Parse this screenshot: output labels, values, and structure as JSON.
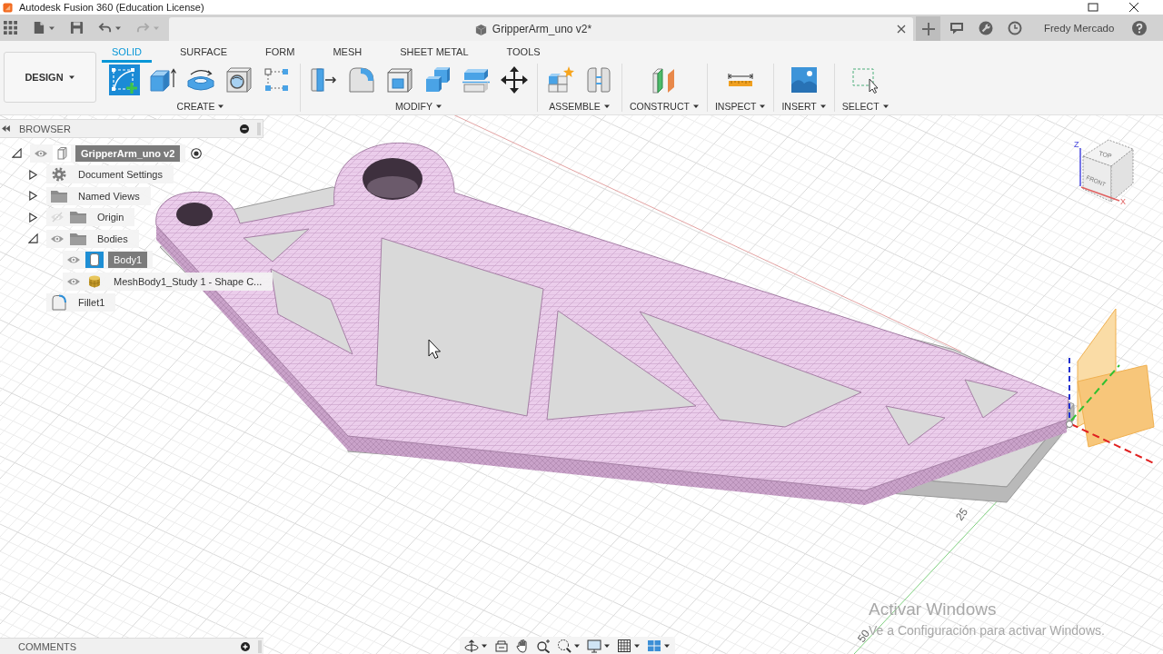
{
  "title_bar": {
    "title": "Autodesk Fusion 360 (Education License)"
  },
  "tab_bar": {
    "quick_access": [
      {
        "kind": "apps",
        "dropdown": false,
        "disabled": false
      },
      {
        "kind": "file",
        "dropdown": true,
        "disabled": false
      },
      {
        "kind": "save",
        "dropdown": false,
        "disabled": false
      },
      {
        "kind": "undo",
        "dropdown": true,
        "disabled": false
      },
      {
        "kind": "redo",
        "dropdown": true,
        "disabled": true
      }
    ],
    "document_tab": {
      "title": "GripperArm_uno v2*",
      "selected": true
    },
    "actions": [
      {
        "kind": "new-tab"
      },
      {
        "kind": "comments"
      },
      {
        "kind": "job-status"
      },
      {
        "kind": "clock"
      }
    ],
    "user_name": "Fredy Mercado"
  },
  "toolbar": {
    "workspace": "DESIGN",
    "tabs": [
      {
        "label": "SOLID",
        "selected": true
      },
      {
        "label": "SURFACE",
        "selected": false
      },
      {
        "label": "FORM",
        "selected": false
      },
      {
        "label": "MESH",
        "selected": false
      },
      {
        "label": "SHEET METAL",
        "selected": false
      },
      {
        "label": "TOOLS",
        "selected": false
      }
    ],
    "groups": [
      {
        "label": "CREATE",
        "tools": [
          {
            "kind": "sketch",
            "selected": true
          },
          {
            "kind": "extrude",
            "selected": false
          },
          {
            "kind": "revolve",
            "selected": false
          },
          {
            "kind": "hole",
            "selected": false
          },
          {
            "kind": "pattern",
            "selected": false
          }
        ]
      },
      {
        "label": "MODIFY",
        "tools": [
          {
            "kind": "press-pull",
            "selected": false
          },
          {
            "kind": "fillet",
            "selected": false
          },
          {
            "kind": "shell",
            "selected": false
          },
          {
            "kind": "combine",
            "selected": false
          },
          {
            "kind": "split",
            "selected": false
          },
          {
            "kind": "move",
            "selected": false
          }
        ]
      },
      {
        "label": "ASSEMBLE",
        "tools": [
          {
            "kind": "new-component",
            "selected": false
          },
          {
            "kind": "joint",
            "selected": false
          }
        ]
      },
      {
        "label": "CONSTRUCT",
        "tools": [
          {
            "kind": "plane",
            "selected": false
          }
        ]
      },
      {
        "label": "INSPECT",
        "tools": [
          {
            "kind": "measure",
            "selected": false
          }
        ]
      },
      {
        "label": "INSERT",
        "tools": [
          {
            "kind": "image",
            "selected": false
          }
        ]
      },
      {
        "label": "SELECT",
        "tools": [
          {
            "kind": "select",
            "selected": false
          }
        ]
      }
    ]
  },
  "browser": {
    "title": "BROWSER",
    "tree": [
      {
        "label": "GripperArm_uno v2",
        "kind": "component",
        "expanded": true,
        "visible": true,
        "active": true,
        "selected": false,
        "children": [
          {
            "label": "Document Settings",
            "kind": "gear",
            "expanded": false,
            "selected": false
          },
          {
            "label": "Named Views",
            "kind": "folder",
            "expanded": false,
            "selected": false
          },
          {
            "label": "Origin",
            "kind": "folder",
            "expanded": false,
            "visible": false,
            "selected": false
          },
          {
            "label": "Bodies",
            "kind": "folder",
            "expanded": true,
            "visible": true,
            "selected": false,
            "children": [
              {
                "label": "Body1",
                "kind": "body",
                "visible": true,
                "selected": true
              },
              {
                "label": "MeshBody1_Study 1 - Shape C...",
                "kind": "mesh",
                "visible": true,
                "selected": false
              }
            ]
          },
          {
            "label": "Fillet1",
            "kind": "fillet",
            "selected": false
          }
        ]
      }
    ]
  },
  "viewport": {
    "view_cube": {
      "top": "TOP",
      "front": "FRONT",
      "z_axis": "Z",
      "x_axis": "X"
    },
    "ruler_labels": [
      "25",
      "50"
    ]
  },
  "comments_panel": {
    "title": "COMMENTS"
  },
  "navigation_bar": {
    "tools": [
      {
        "kind": "orbit",
        "dropdown": true
      },
      {
        "kind": "look-at",
        "dropdown": false
      },
      {
        "kind": "pan",
        "dropdown": false
      },
      {
        "kind": "zoom",
        "dropdown": false
      },
      {
        "kind": "fit",
        "dropdown": true
      },
      {
        "kind": "display",
        "dropdown": true
      },
      {
        "kind": "grid",
        "dropdown": true
      },
      {
        "kind": "viewports",
        "dropdown": true
      }
    ]
  },
  "activation_notice": {
    "title": "Activar Windows",
    "text": "Ve a Configuración para activar Windows."
  }
}
